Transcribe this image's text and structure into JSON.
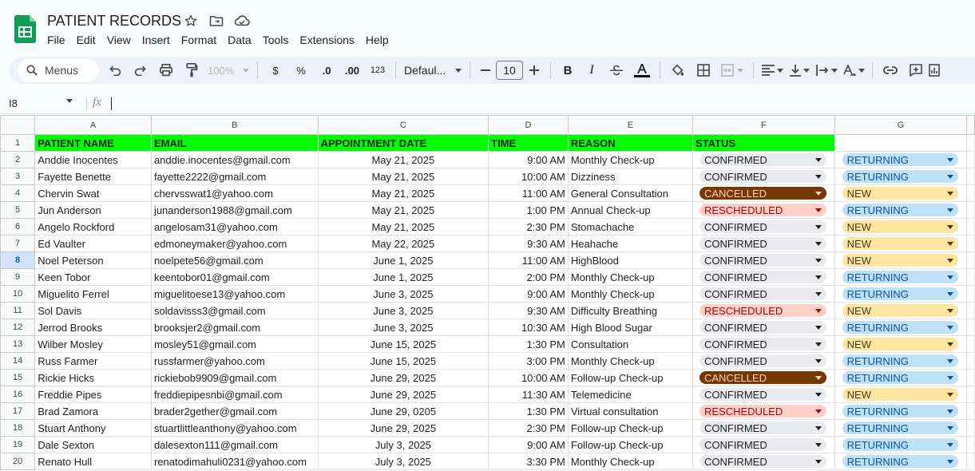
{
  "app": {
    "title": "PATIENT RECORDS",
    "menu": [
      "File",
      "Edit",
      "View",
      "Insert",
      "Format",
      "Data",
      "Tools",
      "Extensions",
      "Help"
    ],
    "accent": "#0b57d0"
  },
  "toolbar": {
    "search_label": "Menus",
    "zoom": "100%",
    "currency": "$",
    "percent": "%",
    "decrease_decimal": ".0",
    "increase_decimal": ".00",
    "number_format": "123",
    "font": "Defaul...",
    "font_size": "10",
    "bold": "B",
    "italic": "I"
  },
  "formula_bar": {
    "cell_ref": "I8",
    "fx": "fx",
    "value": ""
  },
  "grid": {
    "columns": [
      "A",
      "B",
      "C",
      "D",
      "E",
      "F",
      "G"
    ],
    "selected_row": 8,
    "header_row": [
      "PATIENT NAME",
      "EMAIL",
      "APPOINTMENT DATE",
      "TIME",
      "REASON",
      "STATUS",
      ""
    ],
    "header_fill": "#00ff00",
    "rows": [
      [
        "Anddie Inocentes",
        "anddie.inocentes@gmail.com",
        "May 21, 2025",
        "9:00 AM",
        "Monthly Check-up",
        "CONFIRMED",
        "RETURNING"
      ],
      [
        "Fayette Benette",
        "fayette2222@gmail.com",
        "May 21, 2025",
        "10:00 AM",
        "Dizziness",
        "CONFIRMED",
        "RETURNING"
      ],
      [
        "Chervin Swat",
        "chervsswat1@yahoo.com",
        "May 21, 2025",
        "11:00 AM",
        "General Consultation",
        "CANCELLED",
        "NEW"
      ],
      [
        "Jun Anderson",
        "junanderson1988@gmail.com",
        "May 21, 2025",
        "1:00 PM",
        "Annual Check-up",
        "RESCHEDULED",
        "RETURNING"
      ],
      [
        "Angelo Rockford",
        "angelosam31@yahoo.com",
        "May 21, 2025",
        "2:30 PM",
        "Stomachache",
        "CONFIRMED",
        "NEW"
      ],
      [
        "Ed Vaulter",
        "edmoneymaker@yahoo.com",
        "May 22, 2025",
        "9:30 AM",
        "Heahache",
        "CONFIRMED",
        "NEW"
      ],
      [
        "Noel Peterson",
        "noelpete56@gmail.com",
        "June 1, 2025",
        "11:00 AM",
        "HighBlood",
        "CONFIRMED",
        "NEW"
      ],
      [
        "Keen Tobor",
        "keentobor01@gmail.com",
        "June 1, 2025",
        "2:00 PM",
        "Monthly Check-up",
        "CONFIRMED",
        "RETURNING"
      ],
      [
        "Miguelito Ferrel",
        "miguelitoese13@yahoo.com",
        "June 3, 2025",
        "9:00 AM",
        "Monthly Check-up",
        "CONFIRMED",
        "RETURNING"
      ],
      [
        "Sol Davis",
        "soldavisss3@gmail.com",
        "June 3, 2025",
        "9:30 AM",
        "Difficulty Breathing",
        "RESCHEDULED",
        "NEW"
      ],
      [
        "Jerrod Brooks",
        "brooksjer2@gmail.com",
        "June 3, 2025",
        "10:30 AM",
        "High Blood Sugar",
        "CONFIRMED",
        "RETURNING"
      ],
      [
        "Wilber Mosley",
        "mosley51@gmail.com",
        "June 15, 2025",
        "1:30 PM",
        "Consultation",
        "CONFIRMED",
        "NEW"
      ],
      [
        "Russ Farmer",
        "russfarmer@yahoo.com",
        "June 15, 2025",
        "3:00 PM",
        "Monthly Check-up",
        "CONFIRMED",
        "RETURNING"
      ],
      [
        "Rickie Hicks",
        "rickiebob9909@gmail.com",
        "June 29, 2025",
        "10:00 AM",
        "Follow-up Check-up",
        "CANCELLED",
        "RETURNING"
      ],
      [
        "Freddie Pipes",
        "freddiepipesnbi@gmail.com",
        "June 29, 2025",
        "11:30 AM",
        "Telemedicine",
        "CONFIRMED",
        "NEW"
      ],
      [
        "Brad Zamora",
        "brader2gether@gmail.com",
        "June 29, 0205",
        "1:30 PM",
        "Virtual consultation",
        "RESCHEDULED",
        "RETURNING"
      ],
      [
        "Stuart Anthony",
        "stuartlittleanthony@yahoo.com",
        "June 29, 2025",
        "2:30 PM",
        "Follow-up Check-up",
        "CONFIRMED",
        "RETURNING"
      ],
      [
        "Dale Sexton",
        "dalesexton111@gmail.com",
        "July 3, 2025",
        "9:00 AM",
        "Follow-up Check-up",
        "CONFIRMED",
        "RETURNING"
      ],
      [
        "Renato Hull",
        "renatodimahuli0231@yahoo.com",
        "July 3, 2025",
        "3:30 PM",
        "Monthly Check-up",
        "CONFIRMED",
        "RETURNING"
      ]
    ]
  }
}
